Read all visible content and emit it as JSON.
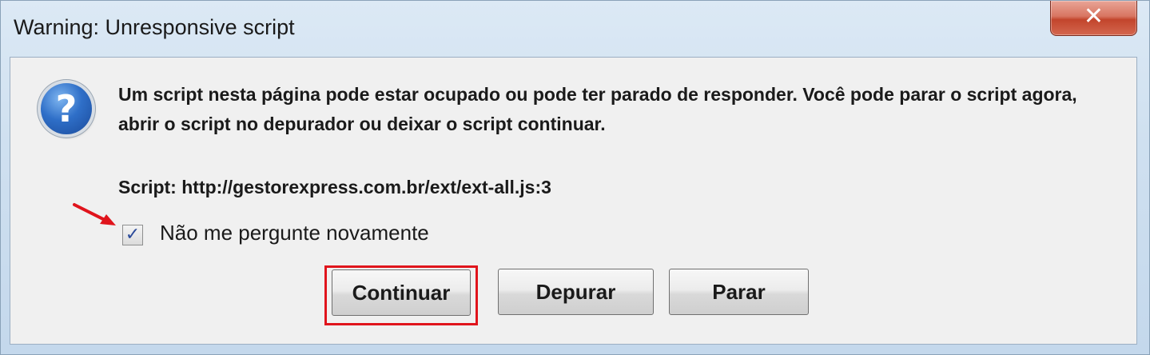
{
  "window": {
    "title": "Warning: Unresponsive script",
    "close_label": "✕"
  },
  "dialog": {
    "icon": "question-icon",
    "message": "Um script nesta página pode estar ocupado ou pode ter parado de responder. Você pode parar o script agora, abrir o script no depurador ou deixar o script continuar.",
    "script_line": "Script: http://gestorexpress.com.br/ext/ext-all.js:3",
    "checkbox": {
      "label": "Não me pergunte novamente",
      "checked": true
    }
  },
  "buttons": {
    "continue": "Continuar",
    "debug": "Depurar",
    "stop": "Parar"
  },
  "annotations": {
    "highlight_color": "#e0141c",
    "arrow_color": "#e0141c"
  }
}
